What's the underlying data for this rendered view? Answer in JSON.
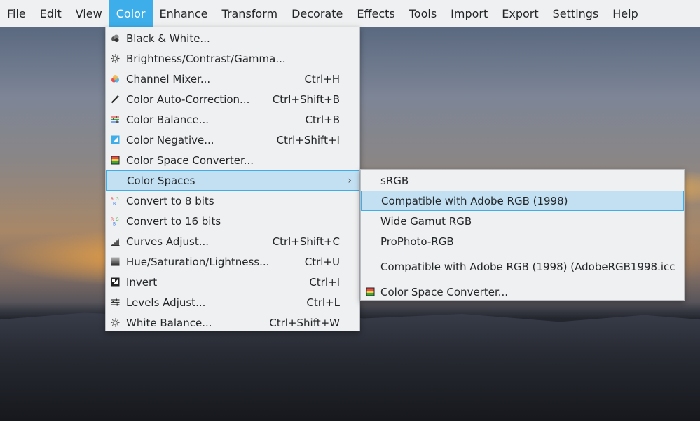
{
  "menubar": {
    "items": [
      "File",
      "Edit",
      "View",
      "Color",
      "Enhance",
      "Transform",
      "Decorate",
      "Effects",
      "Tools",
      "Import",
      "Export",
      "Settings",
      "Help"
    ],
    "active": "Color"
  },
  "color_menu": {
    "items": [
      {
        "label": "Black & White...",
        "shortcut": "",
        "icon": "black-white-icon"
      },
      {
        "label": "Brightness/Contrast/Gamma...",
        "shortcut": "",
        "icon": "brightness-icon"
      },
      {
        "label": "Channel Mixer...",
        "shortcut": "Ctrl+H",
        "icon": "channel-mixer-icon"
      },
      {
        "label": "Color Auto-Correction...",
        "shortcut": "Ctrl+Shift+B",
        "icon": "auto-correction-icon"
      },
      {
        "label": "Color Balance...",
        "shortcut": "Ctrl+B",
        "icon": "color-balance-icon"
      },
      {
        "label": "Color Negative...",
        "shortcut": "Ctrl+Shift+I",
        "icon": "color-negative-icon"
      },
      {
        "label": "Color Space Converter...",
        "shortcut": "",
        "icon": "color-space-converter-icon"
      },
      {
        "label": "Color Spaces",
        "shortcut": "",
        "icon": "",
        "submenu": true
      },
      {
        "label": "Convert to 8 bits",
        "shortcut": "",
        "icon": "convert-8bit-icon"
      },
      {
        "label": "Convert to 16 bits",
        "shortcut": "",
        "icon": "convert-16bit-icon"
      },
      {
        "label": "Curves Adjust...",
        "shortcut": "Ctrl+Shift+C",
        "icon": "curves-icon"
      },
      {
        "label": "Hue/Saturation/Lightness...",
        "shortcut": "Ctrl+U",
        "icon": "hsl-icon"
      },
      {
        "label": "Invert",
        "shortcut": "Ctrl+I",
        "icon": "invert-icon"
      },
      {
        "label": "Levels Adjust...",
        "shortcut": "Ctrl+L",
        "icon": "levels-icon"
      },
      {
        "label": "White Balance...",
        "shortcut": "Ctrl+Shift+W",
        "icon": "white-balance-icon"
      }
    ],
    "highlighted": "Color Spaces"
  },
  "spaces_menu": {
    "items": [
      {
        "label": "sRGB"
      },
      {
        "label": "Compatible with Adobe RGB (1998)"
      },
      {
        "label": "Wide Gamut RGB"
      },
      {
        "label": "ProPhoto-RGB"
      },
      {
        "label": "Compatible with Adobe RGB (1998) (AdobeRGB1998.icc"
      },
      {
        "label": "Color Space Converter...",
        "icon": "color-space-converter-icon"
      }
    ],
    "highlighted": "Compatible with Adobe RGB (1998)"
  },
  "colors": {
    "accent": "#3daee9",
    "highlight": "#c2e0f2",
    "menu_bg": "#eff0f1"
  }
}
